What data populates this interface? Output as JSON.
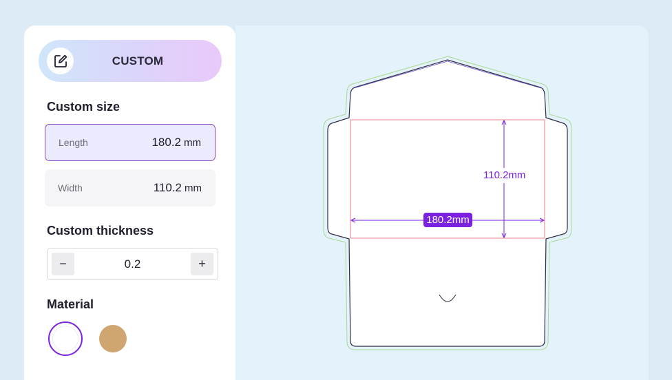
{
  "panel": {
    "mode_label": "CUSTOM",
    "custom_size_title": "Custom size",
    "length": {
      "label": "Length",
      "value": "180.2",
      "unit": "mm"
    },
    "width": {
      "label": "Width",
      "value": "110.2",
      "unit": "mm"
    },
    "thickness_title": "Custom thickness",
    "thickness": {
      "value": "0.2",
      "minus": "−",
      "plus": "+"
    },
    "material_title": "Material",
    "materials": [
      {
        "name": "white",
        "color": "#ffffff",
        "selected": true
      },
      {
        "name": "kraft",
        "color": "#cfa570",
        "selected": false
      }
    ]
  },
  "preview": {
    "height_label": "110.2mm",
    "width_label": "180.2mm"
  },
  "colors": {
    "accent": "#7a22e0",
    "dieline": "#2c2c44",
    "bleed": "#a9d98f",
    "fold": "#e86a7a"
  }
}
